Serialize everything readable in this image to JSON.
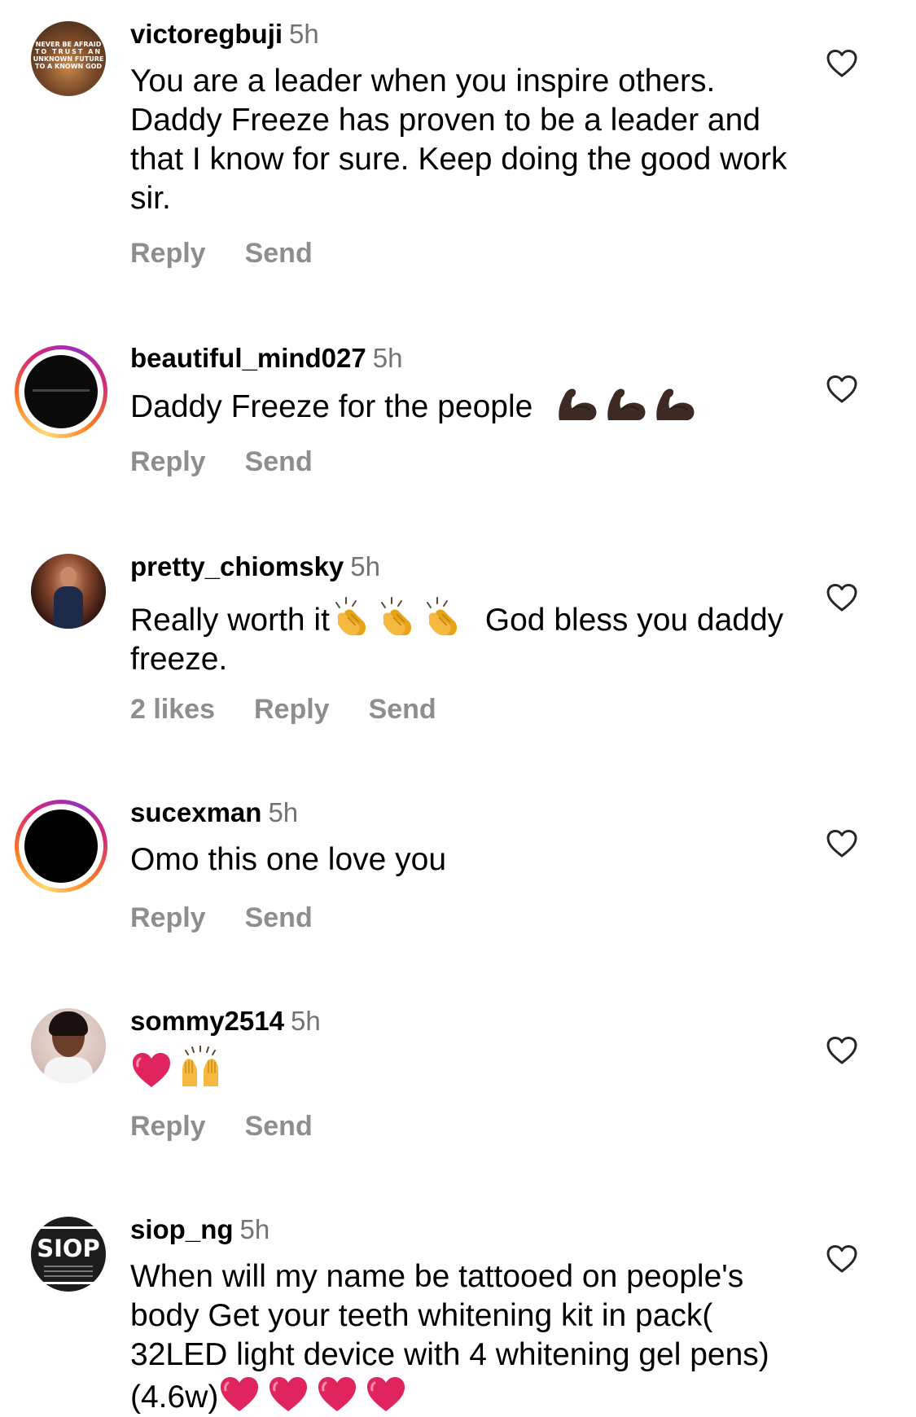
{
  "comments": [
    {
      "username": "victoregbuji",
      "time": "5h",
      "text": "You are a leader when you inspire others. Daddy Freeze has proven to be a leader and that I know for sure. Keep doing the good work sir.",
      "likes": "",
      "reply": "Reply",
      "send": "Send",
      "avatar_text": [
        "NEVER BE AFRAID",
        "TO TRUST AN",
        "UNKNOWN FUTURE",
        "TO A KNOWN GOD"
      ]
    },
    {
      "username": "beautiful_mind027",
      "time": "5h",
      "text": "Daddy Freeze for the people",
      "likes": "",
      "reply": "Reply",
      "send": "Send"
    },
    {
      "username": "pretty_chiomsky",
      "time": "5h",
      "text_a": "Really worth it",
      "text_b": "God bless you daddy freeze.",
      "likes": "2 likes",
      "reply": "Reply",
      "send": "Send"
    },
    {
      "username": "sucexman",
      "time": "5h",
      "text": "Omo this one love you",
      "likes": "",
      "reply": "Reply",
      "send": "Send"
    },
    {
      "username": "sommy2514",
      "time": "5h",
      "text": "",
      "likes": "",
      "reply": "Reply",
      "send": "Send"
    },
    {
      "username": "siop_ng",
      "time": "5h",
      "text": "When will my name be tattooed on people's body  Get your teeth whitening kit in pack( 32LED light device with 4 whitening gel pens) (4.6w)",
      "likes": "",
      "avatar_text": "SIOP"
    }
  ],
  "colors": {
    "muted": "#8e8e8e",
    "time": "#737373",
    "heart_red": "#e0245e",
    "ring_gradient": [
      "#feda75",
      "#fa7e1e",
      "#d62976",
      "#962fbf"
    ]
  },
  "icons": {
    "like": "heart-outline-icon",
    "flexed_biceps": "flexed-biceps-emoji",
    "clapping": "clapping-hands-emoji",
    "raising_hands": "raising-hands-emoji",
    "red_heart": "red-heart-emoji"
  }
}
